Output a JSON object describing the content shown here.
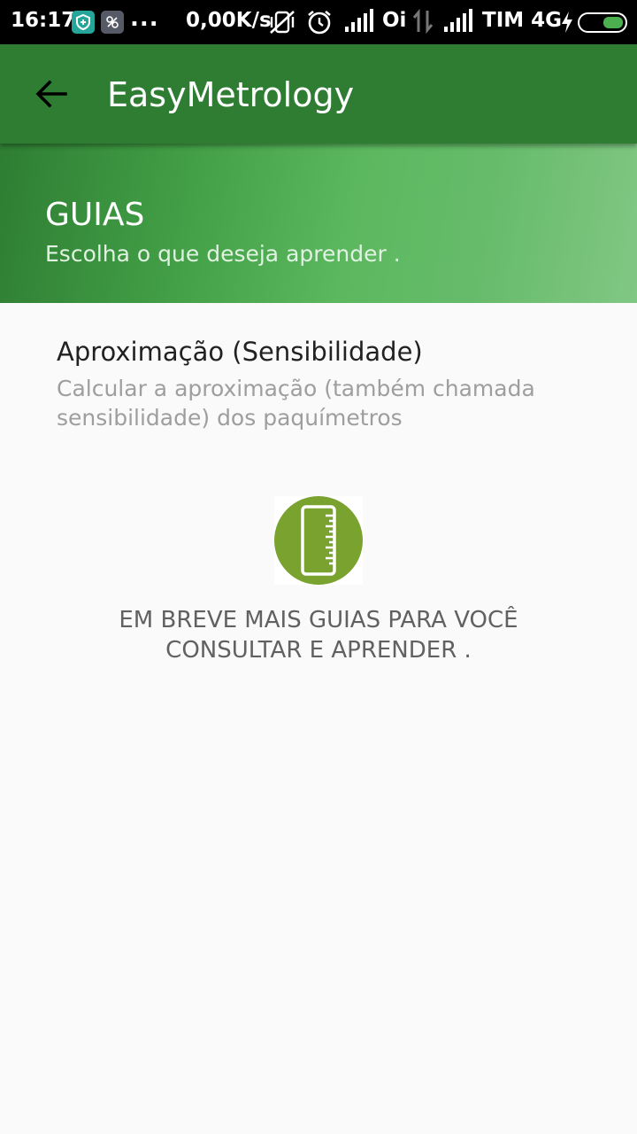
{
  "status_bar": {
    "time": "16:17",
    "dots": "...",
    "net_speed": "0,00K/s",
    "carrier1": "Oi",
    "carrier2": "TIM 4G",
    "battery_color": "#4caf50"
  },
  "app_bar": {
    "title": "EasyMetrology",
    "background": "#2e7d32"
  },
  "header": {
    "title": "GUIAS",
    "subtitle": "Escolha o que deseja aprender ."
  },
  "guides": [
    {
      "title": "Aproximação (Sensibilidade)",
      "description": "Calcular a aproximação (também chamada sensibilidade) dos paquímetros"
    }
  ],
  "empty_state": {
    "icon": "ruler-icon",
    "icon_color": "#7aa22f",
    "message": "EM BREVE MAIS GUIAS PARA VOCÊ CONSULTAR E APRENDER ."
  }
}
